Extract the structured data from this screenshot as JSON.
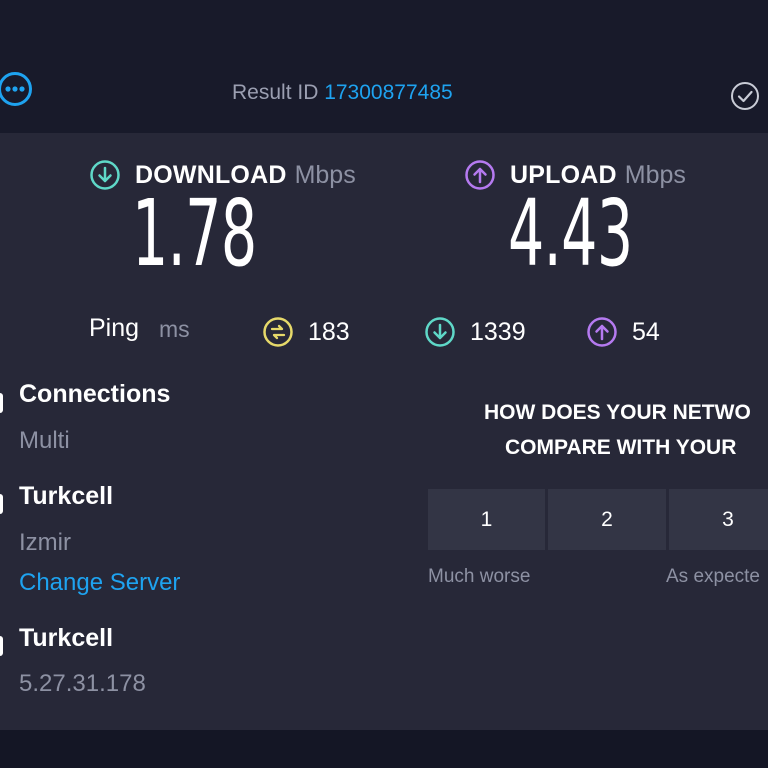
{
  "header": {
    "result_label": "Result ID",
    "result_id": "17300877485"
  },
  "download": {
    "title": "DOWNLOAD",
    "unit": "Mbps",
    "value": "1.78",
    "color": "#5fd8c8"
  },
  "upload": {
    "title": "UPLOAD",
    "unit": "Mbps",
    "value": "4.43",
    "color": "#b57af0"
  },
  "ping": {
    "label": "Ping",
    "unit": "ms",
    "idle": "183",
    "download": "1339",
    "upload": "54",
    "idle_color": "#e6d96a"
  },
  "info": {
    "connections_title": "Connections",
    "connections_value": "Multi",
    "server_name": "Turkcell",
    "server_location": "Izmir",
    "change_server": "Change Server",
    "provider_name": "Turkcell",
    "provider_ip": "5.27.31.178"
  },
  "survey": {
    "question_line1": "HOW DOES YOUR NETWO",
    "question_line2": "COMPARE WITH YOUR",
    "options": [
      "1",
      "2",
      "3"
    ],
    "caption_low": "Much worse",
    "caption_mid": "As expecte"
  },
  "icons": {
    "share": "ellipsis-circle-icon",
    "check": "check-circle-icon",
    "download": "arrow-down-circle-icon",
    "upload": "arrow-up-circle-icon",
    "idle": "idle-latency-icon"
  },
  "colors": {
    "accent": "#1ea3f0",
    "panel": "#272838",
    "background": "#1c1d2e"
  }
}
